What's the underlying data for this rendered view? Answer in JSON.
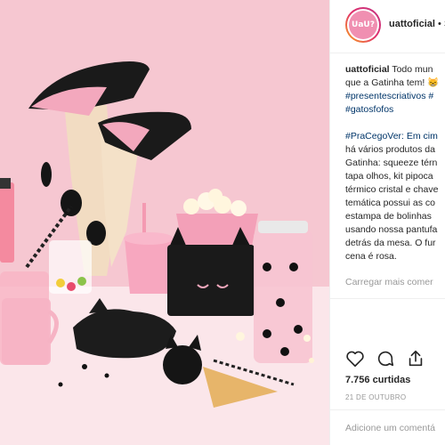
{
  "header": {
    "avatar_text": "UaU?",
    "username": "uattoficial",
    "separator": " • S"
  },
  "caption": {
    "username": "uattoficial",
    "lines": [
      "Todo mun",
      "que a Gatinha tem! 😸",
      "#presentescriativos #",
      "#gatosfofos"
    ],
    "desc_lines": [
      "#PraCegoVer: Em cim",
      "há vários produtos da",
      "Gatinha: squeeze térn",
      "tapa olhos, kit pipoca",
      "térmico cristal e chave",
      "temática possui as co",
      "estampa de bolinhas",
      "usando nossa pantufa",
      "detrás da mesa. O fur",
      "cena é rosa."
    ]
  },
  "load_more": "Carregar mais comer",
  "actions": {
    "like_icon": "heart-icon",
    "comment_icon": "comment-icon",
    "share_icon": "share-icon"
  },
  "likes": "7.756 curtidas",
  "date": "21 DE OUTUBRO",
  "comment": {
    "placeholder": "Adicione um comentá"
  },
  "colors": {
    "background_pink": "#f6c7d1",
    "link_blue": "#003569",
    "follow_blue": "#3897f0"
  }
}
